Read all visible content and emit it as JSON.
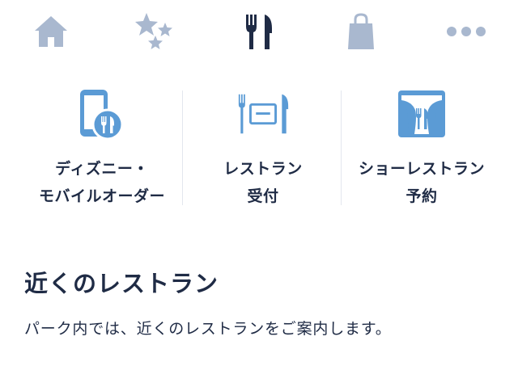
{
  "nav": {
    "items": [
      {
        "icon": "home-icon",
        "active": false
      },
      {
        "icon": "stars-icon",
        "active": false
      },
      {
        "icon": "fork-knife-icon",
        "active": true
      },
      {
        "icon": "shopping-bag-icon",
        "active": false
      },
      {
        "icon": "more-icon",
        "active": false
      }
    ],
    "inactive_color": "#a9b8cf",
    "active_color": "#1f2b45"
  },
  "features": [
    {
      "icon": "mobile-order-icon",
      "line1": "ディズニー・",
      "line2": "モバイルオーダー"
    },
    {
      "icon": "restaurant-reception-icon",
      "line1": "レストラン",
      "line2": "受付"
    },
    {
      "icon": "show-restaurant-icon",
      "line1": "ショーレストラン",
      "line2": "予約"
    }
  ],
  "accent_color": "#5b9bd5",
  "nearby": {
    "title": "近くのレストラン",
    "description": "パーク内では、近くのレストランをご案内します。"
  }
}
